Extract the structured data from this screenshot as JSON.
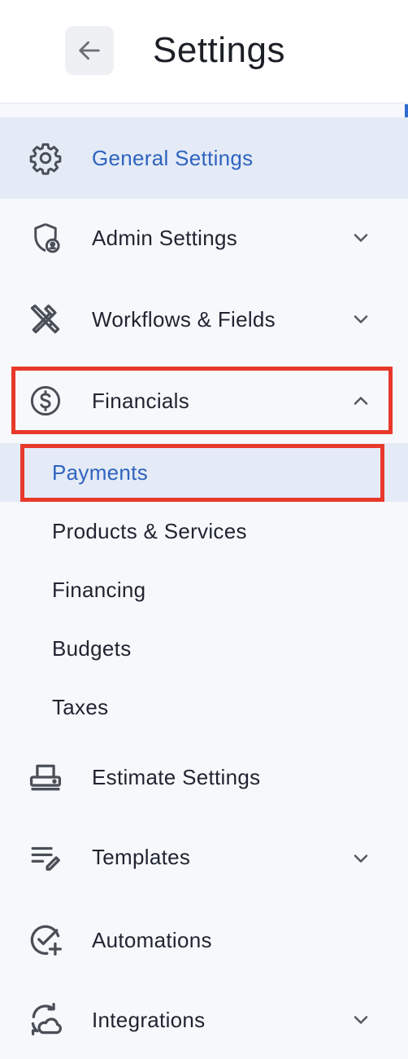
{
  "header": {
    "title": "Settings",
    "back_icon": "arrow-left-icon"
  },
  "nav": {
    "general": {
      "label": "General Settings",
      "icon": "gear-icon",
      "active": true
    },
    "admin": {
      "label": "Admin Settings",
      "icon": "shield-user-icon",
      "expandable": true
    },
    "workflows": {
      "label": "Workflows & Fields",
      "icon": "tools-icon",
      "expandable": true
    },
    "financials": {
      "label": "Financials",
      "icon": "dollar-circle-icon",
      "expanded": true,
      "children": [
        {
          "label": "Payments",
          "active": true
        },
        {
          "label": "Products & Services"
        },
        {
          "label": "Financing"
        },
        {
          "label": "Budgets"
        },
        {
          "label": "Taxes"
        }
      ]
    },
    "estimate": {
      "label": "Estimate Settings",
      "icon": "printer-icon"
    },
    "templates": {
      "label": "Templates",
      "icon": "list-edit-icon",
      "expandable": true
    },
    "automations": {
      "label": "Automations",
      "icon": "check-plus-icon"
    },
    "integrations": {
      "label": "Integrations",
      "icon": "sync-cloud-icon",
      "expandable": true
    }
  },
  "colors": {
    "accent": "#2f63c0",
    "highlight": "#e8392a",
    "active_bg": "#e4ebf6",
    "background": "#f6f8fc"
  }
}
